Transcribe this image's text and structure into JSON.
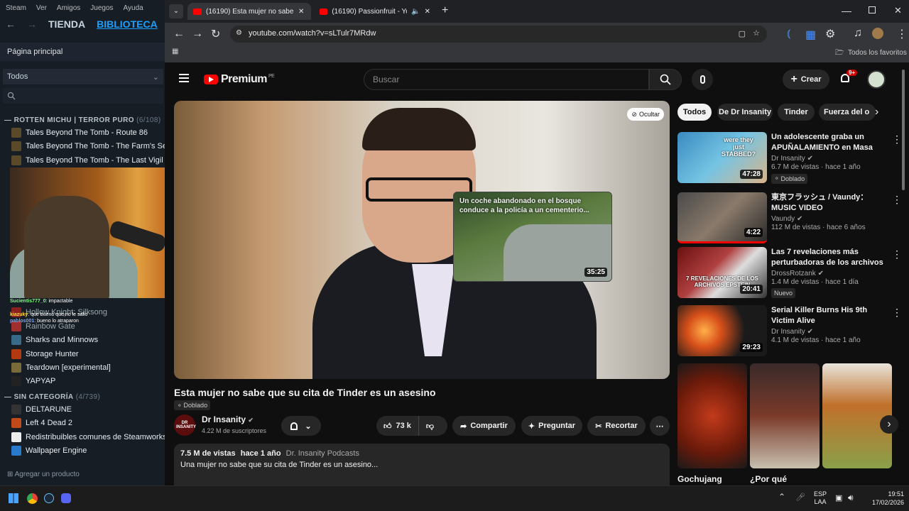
{
  "steam": {
    "menu": [
      "Steam",
      "Ver",
      "Amigos",
      "Juegos",
      "Ayuda"
    ],
    "nav": [
      "TIENDA",
      "BIBLIOTECA",
      "CO"
    ],
    "home": "Página principal",
    "filter": "Todos",
    "category1": {
      "name": "ROTTEN MICHU | TERROR PURO",
      "count": "(6/108)"
    },
    "games1": [
      "Tales Beyond The Tomb - Route 86",
      "Tales Beyond The Tomb - The Farm's Secret",
      "Tales Beyond The Tomb - The Last Vigil"
    ],
    "partial_games": [
      "Hollow Knight: Silksong",
      "Rainbow Gate"
    ],
    "games2": [
      "Sharks and Minnows",
      "Storage Hunter",
      "Teardown [experimental]",
      "YAPYAP"
    ],
    "category2": {
      "name": "SIN CATEGORÍA",
      "count": "(4/739)"
    },
    "games3": [
      "DELTARUNE",
      "Left 4 Dead 2",
      "Redistribuibles comunes de Steamworks",
      "Wallpaper Engine"
    ],
    "add_product": "Agregar un producto"
  },
  "chat": [
    {
      "user": "Sucientis777_0",
      "msg": "impactable"
    },
    {
      "user": "kiazuky",
      "msg": "que bueno que no le salio"
    },
    {
      "user": "pablos001",
      "msg": "bueno lo atraparon"
    }
  ],
  "browser": {
    "tabs": [
      {
        "label": "(16190) Esta mujer no sabe que"
      },
      {
        "label": "(16190) Passionfruit - YouTu"
      }
    ],
    "url": "youtube.com/watch?v=sLTulr7MRdw",
    "bookmarks_all": "Todos los favoritos"
  },
  "youtube": {
    "logo": "Premium",
    "region": "PE",
    "search_placeholder": "Buscar",
    "create": "Crear",
    "notif_badge": "9+",
    "hide_label": "Ocultar",
    "video": {
      "title": "Esta mujer no sabe que su cita de Tinder es un asesino",
      "dubbed": "Doblado",
      "channel": "Dr Insanity",
      "avatar_text": "DR INSANITY",
      "subs": "4.22 M de suscriptores",
      "likes": "73 k",
      "share": "Compartir",
      "ask": "Preguntar",
      "clip": "Recortar",
      "views": "7.5 M de vistas",
      "ago": "hace 1 año",
      "tag": "Dr. Insanity Podcasts",
      "description": "Una mujer no sabe que su cita de Tinder es un asesino..."
    },
    "endscreen": {
      "title": "Un coche abandonado en el bosque conduce a la policía a un cementerio...",
      "duration": "35:25"
    },
    "chips": [
      "Todos",
      "De Dr Insanity",
      "Tinder",
      "Fuerza del o"
    ],
    "recs": [
      {
        "title": "Un adolescente graba un APUÑALAMIENTO en Masa",
        "channel": "Dr Insanity",
        "meta": "6.7 M de vistas · hace 1 año",
        "badge": "Doblado",
        "duration": "47:28",
        "thumb_text": "were they just STABBED?"
      },
      {
        "title": "東京フラッシュ / Vaundy：MUSIC VIDEO",
        "channel": "Vaundy",
        "meta": "112 M de vistas · hace 6 años",
        "badge": "",
        "duration": "4:22",
        "thumb_text": ""
      },
      {
        "title": "Las 7 revelaciones más perturbadoras de los archivos ...",
        "channel": "DrossRotzank",
        "meta": "1.4 M de vistas · hace 1 día",
        "badge": "Nuevo",
        "duration": "20:41",
        "thumb_text": "7 REVELACIONES DE LOS ARCHIVOS EPSTEIN"
      },
      {
        "title": "Serial Killer Burns His 9th Victim Alive",
        "channel": "Dr Insanity",
        "meta": "4.1 M de vistas · hace 1 año",
        "badge": "",
        "duration": "29:23",
        "thumb_text": ""
      }
    ],
    "shorts": [
      "Gochujang",
      "¿Por qué",
      ""
    ]
  },
  "taskbar": {
    "lang1": "ESP",
    "lang2": "LAA",
    "time": "19:51",
    "date": "17/02/2026"
  }
}
